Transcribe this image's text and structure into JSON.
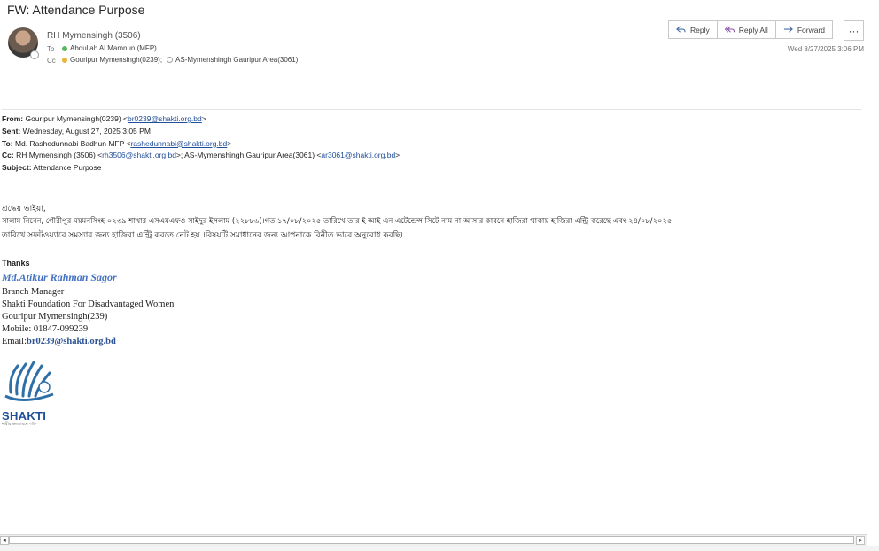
{
  "subject": "FW: Attendance Purpose",
  "sender": "RH Mymensingh (3506)",
  "to_label": "To",
  "to_value": "Abdullah Al Mamnun (MFP)",
  "cc_label": "Cc",
  "cc_values": [
    "Gouripur Mymensingh(0239);",
    "AS-Mymenshingh Gauripur Area(3061)"
  ],
  "actions": {
    "reply": "Reply",
    "reply_all": "Reply All",
    "forward": "Forward",
    "more": "···"
  },
  "date": "Wed 8/27/2025 3:06 PM",
  "forward_header": {
    "from_label": "From:",
    "from_name": " Gouripur Mymensingh(0239) <",
    "from_email": "br0239@shakti.org.bd",
    "from_end": ">",
    "sent_label": "Sent:",
    "sent_value": " Wednesday, August 27, 2025 3:05 PM",
    "to_label": "To:",
    "to_name": " Md. Rashedunnabi Badhun MFP <",
    "to_email": "rashedunnabi@shakti.org.bd",
    "to_end": ">",
    "cc_label": "Cc:",
    "cc_name1": " RH Mymensingh (3506) <",
    "cc_email1": "rh3506@shakti.org.bd",
    "cc_mid": ">; AS-Mymenshingh Gauripur Area(3061) <",
    "cc_email2": "ar3061@shakti.org.bd",
    "cc_end": ">",
    "subject_label": "Subject:",
    "subject_value": " Attendance Purpose"
  },
  "body": {
    "greeting": "শ্রদ্ধেয় ভাইয়া,",
    "line1": "সালাম নিবেন, গৌরীপুর ময়মনসিংহ ০২৩৯ শাখার এসএমএফও সাইদুর ইসলাম (২২৮৮৬)।গত ১৭/০৮/২০২৫ তারিখে তার ই আই এন এটেন্ডেন্স সিটে নাম না আসার কারনে হাজিরা থাকায় হাজিরা এন্ট্রি করেছে এবং ২৪/০৮/২০২৫",
    "line2": "তারিখে সফটওয়্যারে সমস্যার জন্য হাজিরা এন্ট্রি করতে নেট হয় ।বিষয়টি সমাধানের জন্য আপনাকে বিনীত ভাবে অনুরোধ করছি।"
  },
  "signature": {
    "thanks": "Thanks",
    "name": "Md.Atikur Rahman Sagor",
    "title": "Branch Manager",
    "org": "Shakti Foundation For Disadvantaged Women",
    "branch": "Gouripur Mymensingh(239)",
    "mobile": "Mobile: 01847-099239",
    "email_label": "Email:",
    "email": "br0239@shakti.org.bd"
  },
  "logo": {
    "text": "SHAKTI",
    "tagline": "নারীর ক্ষমতায়নে শক্তি"
  },
  "scrollbar": {
    "left": "◂",
    "right": "▸"
  },
  "colors": {
    "link": "#1f4e9a",
    "signature_name": "#4472c4",
    "presence_green": "#5cb85c",
    "presence_yellow": "#e8b43a"
  }
}
